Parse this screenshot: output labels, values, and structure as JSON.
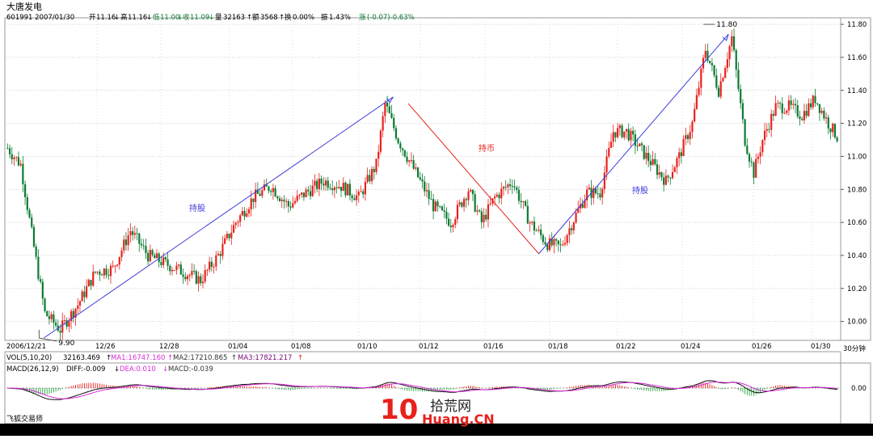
{
  "header": {
    "stock_name": "大唐发电",
    "info_code_date": "601991 2007/01/30",
    "open_label": "开",
    "open_value": "11.16",
    "high_label": "高",
    "high_value": "11.16",
    "low_label": "低",
    "low_value": "11.00",
    "close_label": "收",
    "close_value": "11.09",
    "volume_label": "量",
    "volume_value": "32163",
    "amount_label": "额",
    "amount_value": "3568",
    "turnover_label": "换",
    "turnover_value": "0.00%",
    "amplitude_label": "振",
    "amplitude_value": "1.43%",
    "change_label": "涨",
    "change_value": "(-0.07)-0.63%"
  },
  "volume_panel": {
    "label": "VOL(5,10,20)",
    "vol": "32163.469",
    "ma1": "MA1:16747.160",
    "ma2": "MA2:17210.865",
    "ma3": "MA3:17821.217"
  },
  "macd_panel": {
    "label": "MACD(26,12,9)",
    "diff": "DIFF:-0.009",
    "dea": "DEA:0.010",
    "macd": "MACD:-0.039",
    "zero_tick": "0.00"
  },
  "period_label": "30分钟",
  "software_label": "飞狐交易师",
  "watermark": {
    "digit": "10",
    "site_cn": "拾荒网",
    "site_en": "Huang.CN"
  },
  "colors": {
    "up": "#e8211b",
    "down": "#0a7a32",
    "trend_up": "#3c3cdc",
    "trend_down": "#e8211b",
    "grid": "#cfcfcf"
  },
  "chart_data": {
    "type": "candlestick",
    "y_ticks": [
      10.0,
      10.2,
      10.4,
      10.6,
      10.8,
      11.0,
      11.2,
      11.4,
      11.6,
      11.8
    ],
    "ylim": [
      9.9,
      11.82
    ],
    "y_tick_labels": [
      "10.00",
      "10.20",
      "10.40",
      "10.60",
      "10.80",
      "11.00",
      "11.20",
      "11.40",
      "11.60",
      "11.80"
    ],
    "x_labels": [
      "2006/12/21",
      "12/26",
      "12/28",
      "01/04",
      "01/08",
      "01/10",
      "01/12",
      "01/16",
      "01/18",
      "01/22",
      "01/24",
      "01/26",
      "01/30"
    ],
    "low_marker": "9.90",
    "high_marker": "11.80",
    "annotations": [
      {
        "text": "持股",
        "direction": "up",
        "from": [
          9.9,
          0.045
        ],
        "to": [
          11.36,
          0.465
        ]
      },
      {
        "text": "持币",
        "direction": "down",
        "from": [
          11.32,
          0.483
        ],
        "to": [
          10.41,
          0.64
        ]
      },
      {
        "text": "持股",
        "direction": "up",
        "from": [
          10.41,
          0.64
        ],
        "to": [
          11.74,
          0.868
        ]
      }
    ],
    "anchors": [
      [
        0,
        11.05
      ],
      [
        6,
        10.95
      ],
      [
        12,
        10.45
      ],
      [
        17,
        10.05
      ],
      [
        24,
        9.95
      ],
      [
        32,
        10.1
      ],
      [
        40,
        10.3
      ],
      [
        48,
        10.32
      ],
      [
        56,
        10.55
      ],
      [
        64,
        10.4
      ],
      [
        72,
        10.35
      ],
      [
        80,
        10.3
      ],
      [
        88,
        10.25
      ],
      [
        96,
        10.4
      ],
      [
        104,
        10.6
      ],
      [
        112,
        10.75
      ],
      [
        120,
        10.82
      ],
      [
        128,
        10.7
      ],
      [
        136,
        10.78
      ],
      [
        144,
        10.85
      ],
      [
        152,
        10.82
      ],
      [
        160,
        10.75
      ],
      [
        168,
        10.95
      ],
      [
        172,
        11.32
      ],
      [
        178,
        11.1
      ],
      [
        186,
        10.9
      ],
      [
        194,
        10.7
      ],
      [
        202,
        10.6
      ],
      [
        210,
        10.8
      ],
      [
        216,
        10.6
      ],
      [
        222,
        10.75
      ],
      [
        230,
        10.85
      ],
      [
        238,
        10.6
      ],
      [
        246,
        10.47
      ],
      [
        252,
        10.45
      ],
      [
        258,
        10.62
      ],
      [
        264,
        10.78
      ],
      [
        270,
        10.78
      ],
      [
        276,
        11.15
      ],
      [
        282,
        11.15
      ],
      [
        288,
        11.05
      ],
      [
        294,
        10.95
      ],
      [
        300,
        10.85
      ],
      [
        306,
        11.0
      ],
      [
        312,
        11.2
      ],
      [
        318,
        11.65
      ],
      [
        324,
        11.4
      ],
      [
        330,
        11.72
      ],
      [
        336,
        11.1
      ],
      [
        340,
        10.9
      ],
      [
        344,
        11.1
      ],
      [
        350,
        11.3
      ],
      [
        356,
        11.3
      ],
      [
        362,
        11.25
      ],
      [
        368,
        11.35
      ],
      [
        374,
        11.2
      ],
      [
        378,
        11.12
      ]
    ],
    "candle_count": 379,
    "volume_series": [
      "VOL",
      "MA1",
      "MA2",
      "MA3"
    ],
    "macd_series": [
      "DIFF",
      "DEA",
      "MACD"
    ]
  }
}
